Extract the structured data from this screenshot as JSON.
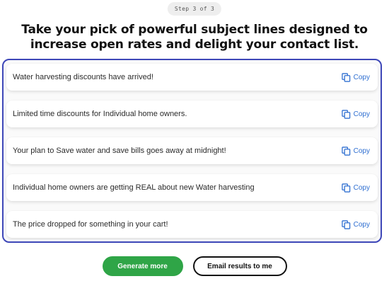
{
  "step_label": "Step 3 of 3",
  "headline": {
    "line1": "Take your pick of powerful subject lines designed to",
    "line2": "increase open rates and delight your contact list."
  },
  "subject_lines": [
    {
      "text": "Water harvesting discounts have arrived!",
      "copy_label": "Copy"
    },
    {
      "text": "Limited time discounts for Individual home owners.",
      "copy_label": "Copy"
    },
    {
      "text": "Your plan to Save water and save bills goes away at midnight!",
      "copy_label": "Copy"
    },
    {
      "text": "Individual home owners are getting REAL about new Water harvesting",
      "copy_label": "Copy"
    },
    {
      "text": "The price dropped for something in your cart!",
      "copy_label": "Copy"
    }
  ],
  "actions": {
    "generate_more": "Generate more",
    "email_results": "Email results to me"
  },
  "colors": {
    "accent_border": "#3e47b8",
    "link_blue": "#2f6fd1",
    "primary_green": "#2fa547"
  },
  "icons": {
    "copy": "copy-icon"
  }
}
